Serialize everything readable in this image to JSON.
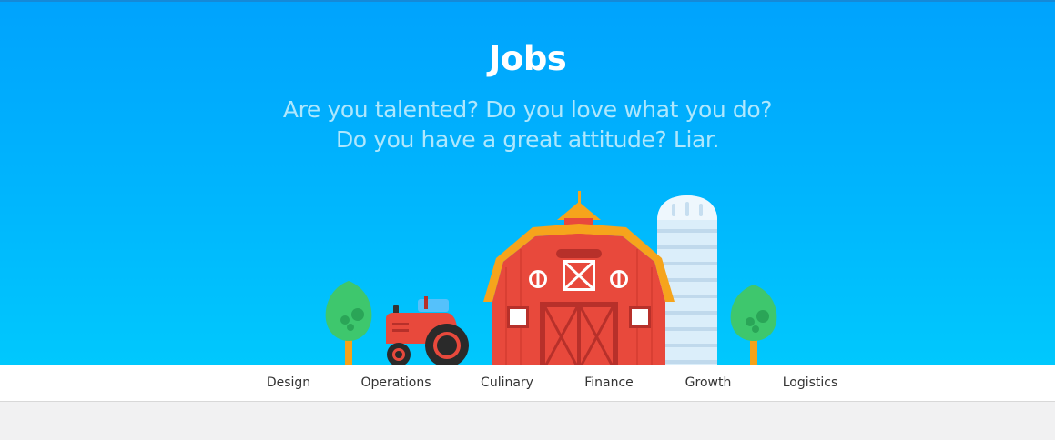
{
  "hero": {
    "title": "Jobs",
    "subtitle_line1": "Are you talented? Do you love what you do?",
    "subtitle_line2": "Do you have a great attitude? Liar."
  },
  "illustration": {
    "elements": [
      "tree-icon",
      "tractor-icon",
      "barn-icon",
      "silo-icon",
      "tree-icon"
    ]
  },
  "nav": {
    "items": [
      {
        "label": "Design"
      },
      {
        "label": "Operations"
      },
      {
        "label": "Culinary"
      },
      {
        "label": "Finance"
      },
      {
        "label": "Growth"
      },
      {
        "label": "Logistics"
      }
    ]
  },
  "colors": {
    "sky_top": "#00a3fd",
    "sky_bottom": "#00c8fd",
    "barn_red": "#e8493c",
    "roof_orange": "#f6a41c",
    "tree_green": "#3ec76d",
    "trunk_orange": "#f5a21a",
    "silo": "#dbeefa"
  }
}
